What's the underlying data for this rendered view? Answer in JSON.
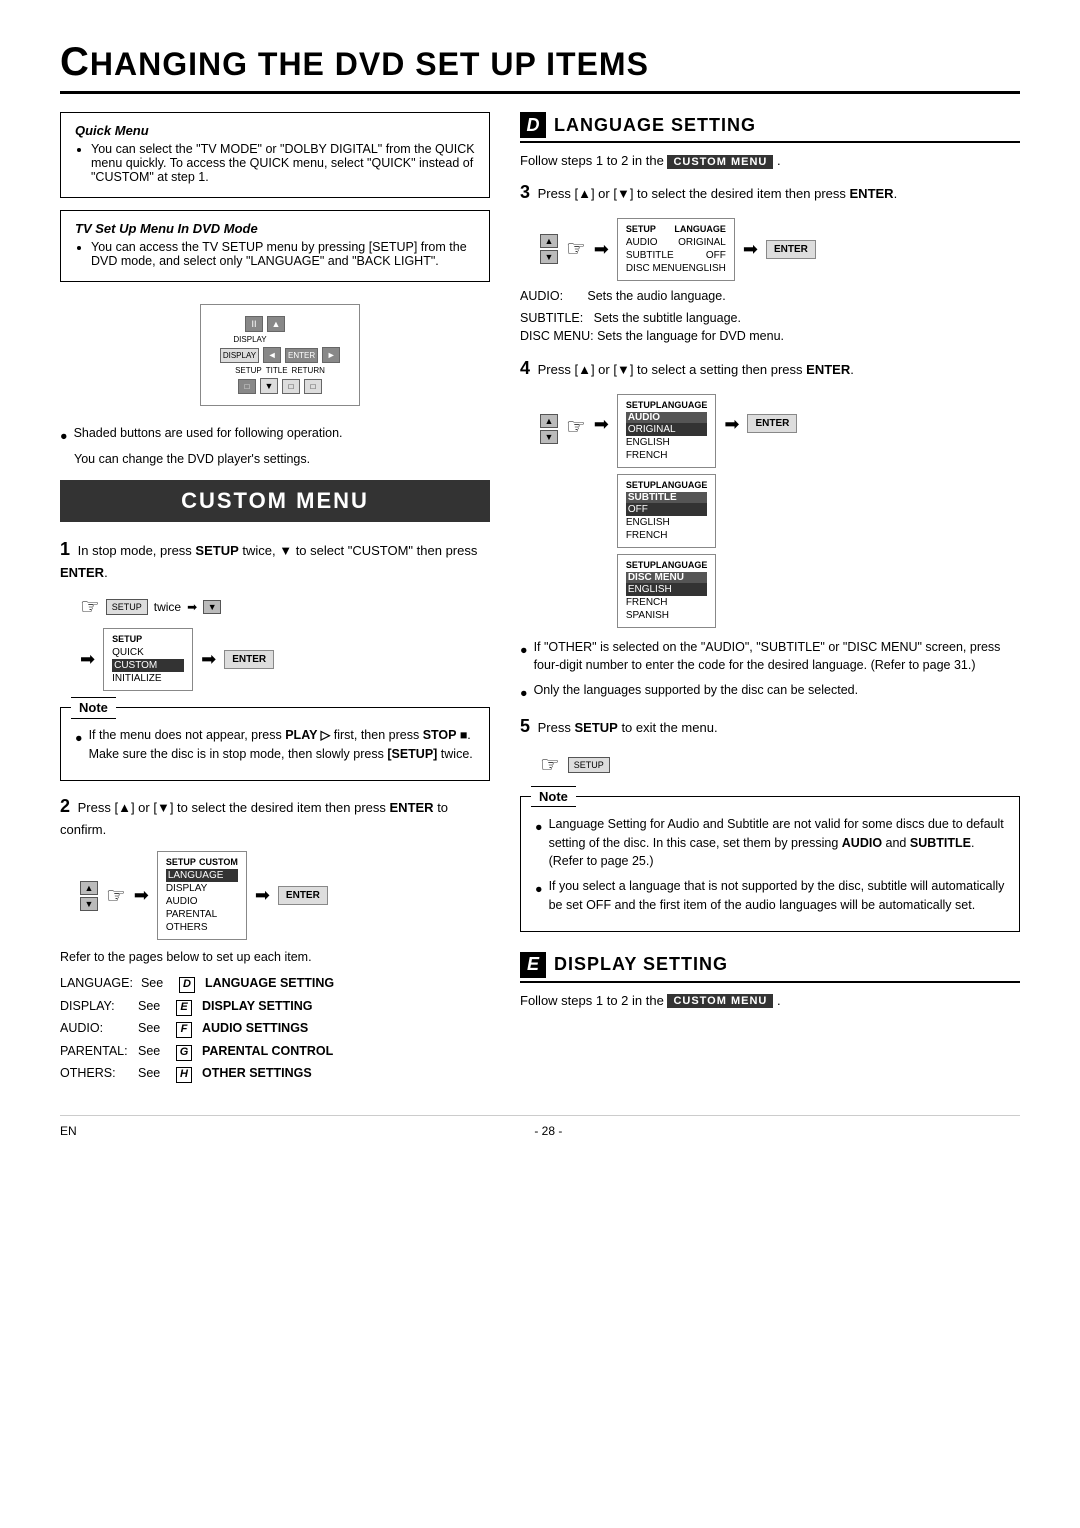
{
  "page": {
    "title": "HANGING THE DVD SET UP ITEMS",
    "title_first": "C",
    "footer_left": "EN",
    "footer_center": "- 28 -"
  },
  "left": {
    "quick_menu_title": "Quick Menu",
    "quick_menu_text": "You can select the \"TV MODE\" or \"DOLBY DIGITAL\" from the QUICK menu quickly. To access the QUICK menu, select \"QUICK\" instead of \"CUSTOM\" at step 1.",
    "tv_setup_title": "TV Set Up Menu In DVD Mode",
    "tv_setup_text": "You can access the TV SETUP menu by pressing [SETUP] from the DVD mode, and select only \"LANGUAGE\" and \"BACK LIGHT\".",
    "shaded_note": "Shaded buttons are used for following operation.",
    "settings_note": "You can change the DVD player's settings.",
    "custom_menu_banner": "CUSTOM MENU",
    "step1_text": "In stop mode, press SETUP twice, ▼ to select \"CUSTOM\" then press ENTER.",
    "step1_twice": "twice",
    "step1_screen": {
      "items": [
        "QUICK",
        "CUSTOM",
        "INITIALIZE"
      ],
      "selected": "CUSTOM"
    },
    "note_title": "Note",
    "note_items": [
      "If the menu does not appear, press PLAY ▷ first, then press STOP ■. Make sure the disc is in stop mode, then slowly press [SETUP] twice.",
      ""
    ],
    "step2_text": "Press [▲] or [▼] to select the desired item then press ENTER to confirm.",
    "step2_screen": {
      "header_left": "SETUP",
      "header_right": "CUSTOM",
      "items": [
        "LANGUAGE",
        "DISPLAY",
        "AUDIO",
        "PARENTAL",
        "OTHERS"
      ],
      "selected": "LANGUAGE"
    },
    "refer_intro": "Refer to the pages below to set up each item.",
    "refer_rows": [
      {
        "label": "LANGUAGE:",
        "see": "See",
        "letter": "D",
        "desc": "LANGUAGE SETTING"
      },
      {
        "label": "DISPLAY:",
        "see": "See",
        "letter": "E",
        "desc": "DISPLAY SETTING"
      },
      {
        "label": "AUDIO:",
        "see": "See",
        "letter": "F",
        "desc": "AUDIO SETTINGS"
      },
      {
        "label": "PARENTAL:",
        "see": "See",
        "letter": "G",
        "desc": "PARENTAL CONTROL"
      },
      {
        "label": "OTHERS:",
        "see": "See",
        "letter": "H",
        "desc": "OTHER SETTINGS"
      }
    ]
  },
  "right": {
    "section_d_letter": "D",
    "section_d_title": "LANGUAGE SETTING",
    "follow_steps_prefix": "Follow steps 1 to 2 in the",
    "custom_menu_tag": "CUSTOM MENU",
    "follow_steps_suffix": ".",
    "step3_text": "Press [▲] or [▼] to select the desired item then press ENTER.",
    "step3_screen": {
      "header_left": "SETUP",
      "header_right": "LANGUAGE",
      "items": [
        {
          "label": "AUDIO",
          "value": "ORIGINAL"
        },
        {
          "label": "SUBTITLE",
          "value": "OFF"
        },
        {
          "label": "DISC MENU",
          "value": "ENGLISH"
        }
      ]
    },
    "audio_desc": "AUDIO:       Sets the audio language.",
    "subtitle_desc": "SUBTITLE:   Sets the subtitle language.",
    "disc_menu_desc": "DISC MENU: Sets the language for DVD menu.",
    "step4_text": "Press [▲] or [▼] to select a setting then press ENTER.",
    "step4_screens": [
      {
        "header_left": "SETUP",
        "header_right": "LANGUAGE",
        "label": "AUDIO",
        "items": [
          "ORIGINAL",
          "ENGLISH",
          "FRENCH"
        ],
        "selected": "ORIGINAL"
      },
      {
        "header_left": "SETUP",
        "header_right": "LANGUAGE",
        "label": "SUBTITLE",
        "items": [
          "OFF",
          "ENGLISH",
          "FRENCH"
        ],
        "selected": "OFF"
      },
      {
        "header_left": "SETUP",
        "header_right": "LANGUAGE",
        "label": "DISC MENU",
        "items": [
          "ENGLISH",
          "FRENCH",
          "SPANISH"
        ],
        "selected": "ENGLISH"
      }
    ],
    "bullet1": "If \"OTHER\" is selected on the \"AUDIO\", \"SUBTITLE\" or \"DISC MENU\" screen, press four-digit number to enter the code for the desired language. (Refer to page 31.)",
    "bullet2": "Only the languages supported by the disc can be selected.",
    "step5_text": "Press SETUP to exit the menu.",
    "note2_title": "Note",
    "note2_items": [
      "Language Setting for Audio and Subtitle are not valid for some discs due to default setting of the disc. In this case, set them by pressing AUDIO and SUBTITLE. (Refer to page 25.)",
      "If you select a language that is not supported by the disc, subtitle will automatically be set OFF and the first item of the audio languages will be automatically set."
    ],
    "section_e_letter": "E",
    "section_e_title": "DISPLAY SETTING",
    "follow_steps_e_prefix": "Follow steps 1 to 2 in the",
    "follow_steps_e_suffix": "."
  }
}
